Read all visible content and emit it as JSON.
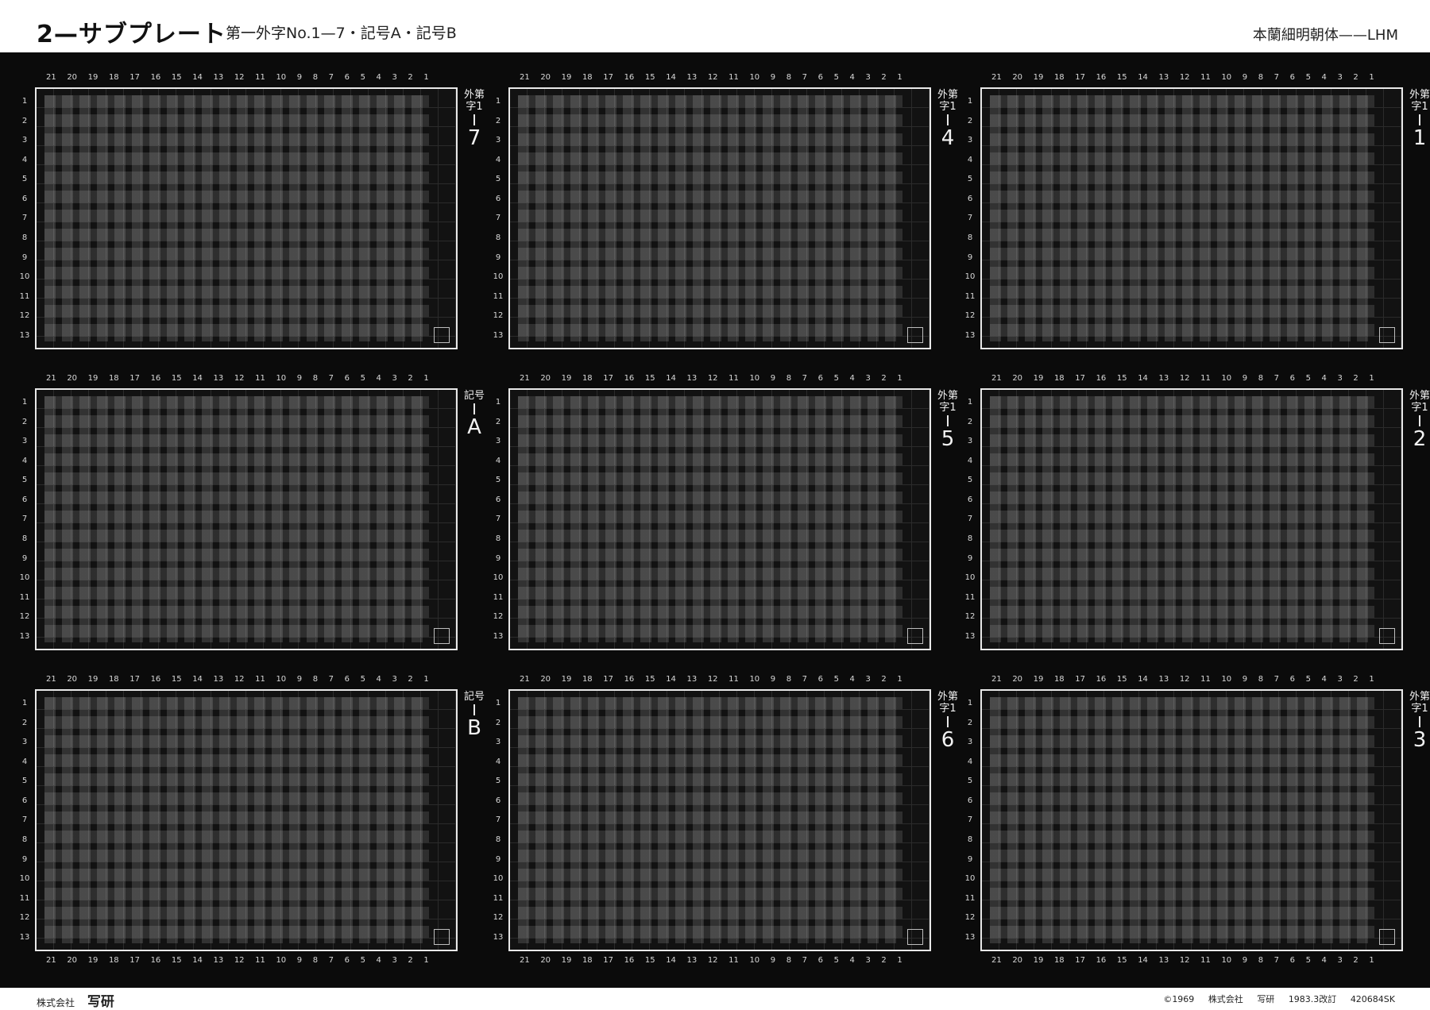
{
  "header": {
    "title": "2—サブプレート",
    "subtitle": "第一外字No.1—7・記号A・記号B",
    "right": "本蘭細明朝体——LHM"
  },
  "column_numbers": [
    "21",
    "20",
    "19",
    "18",
    "17",
    "16",
    "15",
    "14",
    "13",
    "12",
    "11",
    "10",
    "9",
    "8",
    "7",
    "6",
    "5",
    "4",
    "3",
    "2",
    "1"
  ],
  "row_numbers": [
    "1",
    "2",
    "3",
    "4",
    "5",
    "6",
    "7",
    "8",
    "9",
    "10",
    "11",
    "12",
    "13"
  ],
  "panels": [
    {
      "label": "外第字1",
      "number": "7"
    },
    {
      "label": "外第字1",
      "number": "4"
    },
    {
      "label": "外第字1",
      "number": "1"
    },
    {
      "label": "記号",
      "number": "A"
    },
    {
      "label": "外第字1",
      "number": "5"
    },
    {
      "label": "外第字1",
      "number": "2"
    },
    {
      "label": "記号",
      "number": "B"
    },
    {
      "label": "外第字1",
      "number": "6"
    },
    {
      "label": "外第字1",
      "number": "3"
    }
  ],
  "footer": {
    "company": "株式会社",
    "brand": "写研",
    "copyright": "©1969",
    "company2": "株式会社",
    "brand2": "写研",
    "revision": "1983.3改訂",
    "code": "420684SK"
  }
}
